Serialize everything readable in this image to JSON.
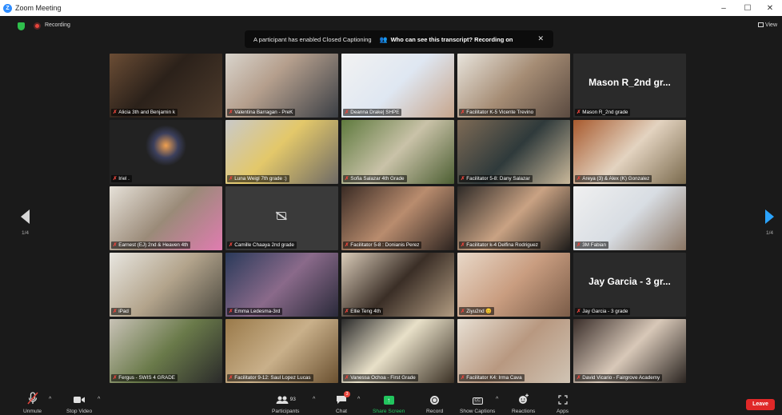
{
  "window": {
    "title": "Zoom Meeting",
    "controls": [
      "–",
      "☐",
      "✕"
    ]
  },
  "topbar": {
    "recording_label": "Recording",
    "view_label": "View"
  },
  "banner": {
    "message": "A participant has enabled Closed Captioning",
    "who_label": "Who can see this transcript? Recording on",
    "close": "✕"
  },
  "pagination": {
    "left": "1/4",
    "right": "1/4"
  },
  "tiles": [
    {
      "name": "Alicia 3th and Benjamin k",
      "bg": "linear-gradient(135deg,#6b4d35 0%,#2b211a 45%,#4d3b2c 100%)"
    },
    {
      "name": "Valentina Barragan - PreK",
      "bg": "linear-gradient(135deg,#d9d4cc 0%,#b59f8d 40%,#3b3f45 100%)"
    },
    {
      "name": "Deanna Drake| SHPE",
      "bg": "linear-gradient(135deg,#f2f2f2 0%,#dfe7f2 50%,#c6a58c 100%)",
      "active": true
    },
    {
      "name": "Facilitator K-5 Vicente Trevino",
      "bg": "linear-gradient(135deg,#e8e4dc 0%,#a58c74 50%,#5a4a40 100%)"
    },
    {
      "name": "Mason R_2nd grade",
      "bg": "#2a2a2a",
      "big_name": "Mason R_2nd gr..."
    },
    {
      "name": "Iriel .",
      "bg": "radial-gradient(circle at 50% 40%,#f0a050 0%,#3b3f5c 18%,#222 30%)"
    },
    {
      "name": "Luna Weigl 7th grade :)",
      "bg": "linear-gradient(135deg,#c9c9c9 0%,#e3c86a 45%,#6e6a65 100%)"
    },
    {
      "name": "Sofia Salazar 4th Grade",
      "bg": "linear-gradient(135deg,#5f7a3e 0%,#c9c2a8 50%,#4d5f33 100%)"
    },
    {
      "name": "Facilitator 5-8: Dany Salazar",
      "bg": "linear-gradient(135deg,#7d6a55 0%,#2f3a3b 50%,#c9b89a 100%)"
    },
    {
      "name": "Areya (3) & Alex (K) Gonzalez",
      "bg": "linear-gradient(135deg,#a85a2e 0%,#e3d3c0 50%,#7a6a4d 100%)"
    },
    {
      "name": "Earnest (EJ) 2nd & Heaven 4th",
      "bg": "linear-gradient(135deg,#e6e1d8 0%,#9a8a78 50%,#e07cb0 100%)"
    },
    {
      "name": "Camille Chaaya 2nd grade",
      "bg": "#3a3a3a",
      "cam_off": true
    },
    {
      "name": "Facilitator 5-8 : Donianis Perez",
      "bg": "linear-gradient(135deg,#3a2b24 0%,#b98c6e 50%,#2d2420 100%)"
    },
    {
      "name": "Facilitator k-4 Delfina Rodriguez",
      "bg": "linear-gradient(135deg,#2e2a27 0%,#c9a283 50%,#1e1c1a 100%)"
    },
    {
      "name": "3M Fabian",
      "bg": "linear-gradient(135deg,#f0f0f0 0%,#d8dde3 50%,#8a7563 100%)"
    },
    {
      "name": "iPad",
      "bg": "linear-gradient(135deg,#e8e6e0 0%,#b3a48c 50%,#4d4a40 100%)"
    },
    {
      "name": "Emma Ledesma-3rd",
      "bg": "linear-gradient(135deg,#2a3a5a 0%,#8a6a8a 50%,#2a2a3a 100%)"
    },
    {
      "name": "Ellie Teng 4th",
      "bg": "linear-gradient(135deg,#d9cbb8 0%,#3a2e26 50%,#b09a80 100%)"
    },
    {
      "name": "Ziyu2nd 😊",
      "bg": "linear-gradient(135deg,#e8d8c8 0%,#c99d80 50%,#7a5c48 100%)"
    },
    {
      "name": "Jay Garcia - 3 grade",
      "bg": "#2a2a2a",
      "big_name": "Jay Garcia - 3 gr..."
    },
    {
      "name": "Fergus - SWIS 4 GRADE",
      "bg": "linear-gradient(135deg,#c8c2b6 0%,#6a7a4a 50%,#2a2a2a 100%)"
    },
    {
      "name": "Facilitator 9-12: Saul Lopez Lucas",
      "bg": "linear-gradient(135deg,#9a7a4a 0%,#c9b08a 50%,#6a5030 100%)"
    },
    {
      "name": "Vanessa Ochoa - First Grade",
      "bg": "linear-gradient(135deg,#2a2a2a 0%,#e8e0c8 45%,#3a3024 100%)"
    },
    {
      "name": "Facilitator K4: Irma Cava",
      "bg": "linear-gradient(135deg,#e8e0d4 0%,#b89880 50%,#d0c4b4 100%)"
    },
    {
      "name": "David Vicario - Fairgrove Academy",
      "bg": "linear-gradient(135deg,#3a2e2a 0%,#d8c8b8 50%,#2a2420 100%)"
    }
  ],
  "toolbar": {
    "unmute": "Unmute",
    "stop_video": "Stop Video",
    "participants": "Participants",
    "participants_count": "93",
    "chat": "Chat",
    "chat_badge": "3",
    "share_screen": "Share Screen",
    "record": "Record",
    "show_captions": "Show Captions",
    "reactions": "Reactions",
    "apps": "Apps",
    "leave": "Leave",
    "caret": "^"
  },
  "colors": {
    "accent": "#2d8cff",
    "share_green": "#22c55e",
    "leave_red": "#e02828",
    "recording_red": "#e8453c",
    "active_speaker": "#d9f06b"
  }
}
